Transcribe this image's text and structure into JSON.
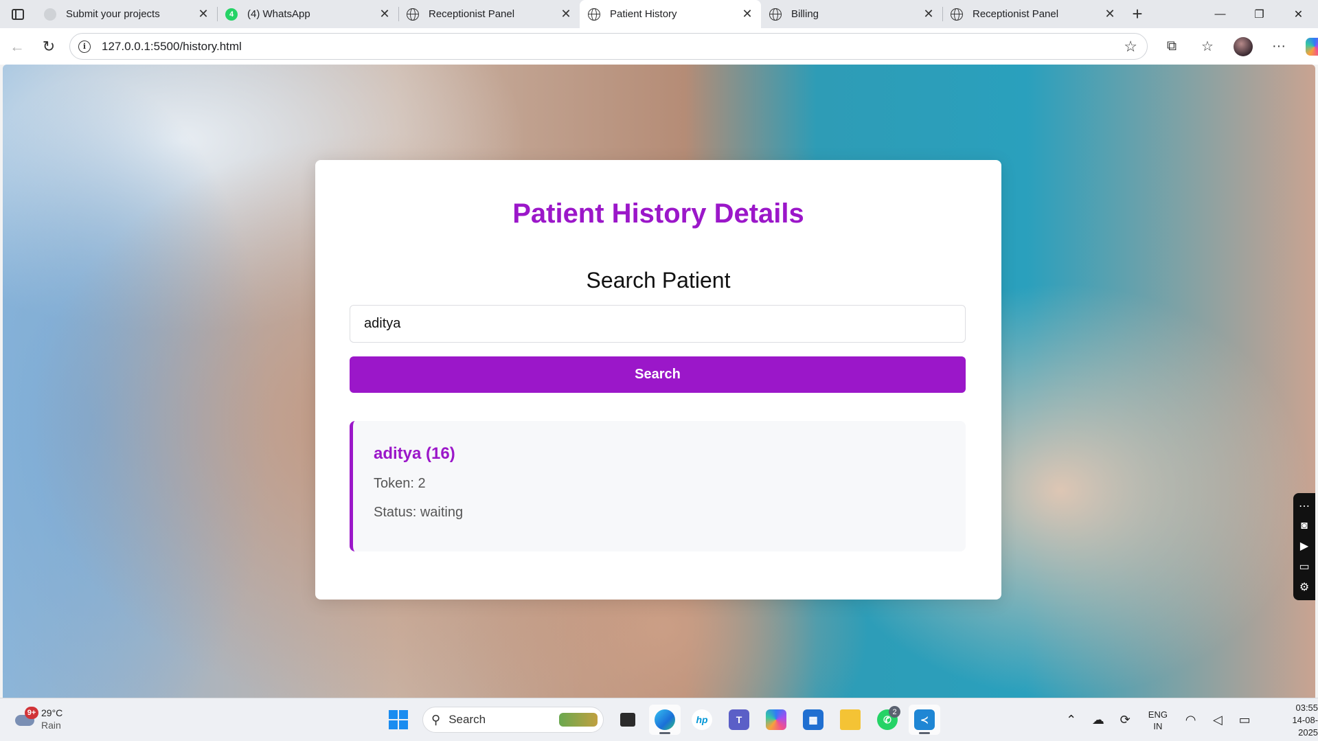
{
  "browser": {
    "tabs": [
      {
        "title": "Submit your projects",
        "icon": "gray-circle-icon",
        "active": false
      },
      {
        "title": "(4) WhatsApp",
        "icon": "whatsapp-icon",
        "badge": "4",
        "active": false
      },
      {
        "title": "Receptionist Panel",
        "icon": "globe-icon",
        "active": false
      },
      {
        "title": "Patient History",
        "icon": "globe-icon",
        "active": true
      },
      {
        "title": "Billing",
        "icon": "globe-icon",
        "active": false
      },
      {
        "title": "Receptionist Panel",
        "icon": "globe-icon",
        "active": false
      }
    ],
    "address": "127.0.0.1:5500/history.html"
  },
  "page": {
    "title": "Patient History Details",
    "search_heading": "Search Patient",
    "search_value": "aditya",
    "search_button": "Search",
    "result": {
      "name": "aditya (16)",
      "token": "Token: 2",
      "status": "Status: waiting"
    },
    "accent_color": "#9b17c9"
  },
  "taskbar": {
    "weather": {
      "badge": "9+",
      "temp": "29°C",
      "condition": "Rain"
    },
    "search_label": "Search",
    "whatsapp_badge": "2",
    "lang_top": "ENG",
    "lang_bottom": "IN",
    "time": "03:55",
    "date": "14-08-2025"
  }
}
